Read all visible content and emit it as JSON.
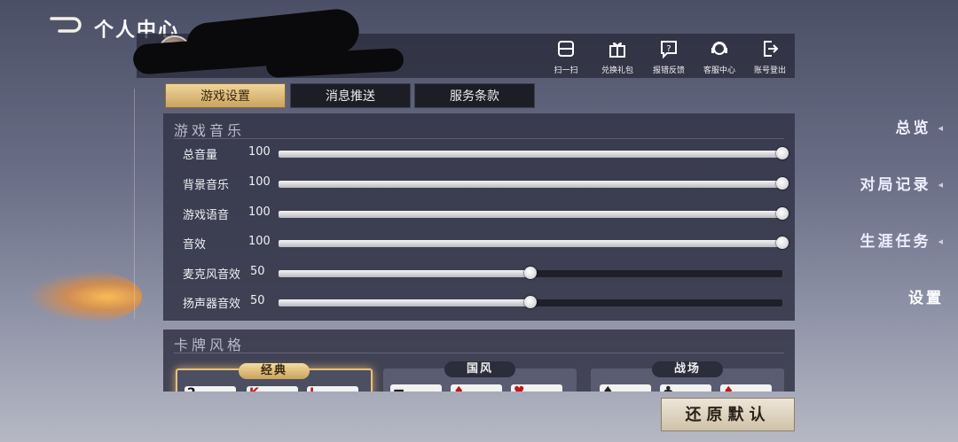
{
  "header": {
    "title": "个人中心"
  },
  "sidebar": {
    "items": [
      {
        "label": "总览"
      },
      {
        "label": "对局记录"
      },
      {
        "label": "生涯任务"
      },
      {
        "label": "设置"
      }
    ]
  },
  "top_actions": [
    {
      "label": "扫一扫",
      "icon": "scan-icon"
    },
    {
      "label": "兑换礼包",
      "icon": "gift-icon"
    },
    {
      "label": "报错反馈",
      "icon": "feedback-icon"
    },
    {
      "label": "客服中心",
      "icon": "support-icon"
    },
    {
      "label": "账号登出",
      "icon": "logout-icon"
    }
  ],
  "tabs": [
    {
      "label": "游戏设置",
      "active": true
    },
    {
      "label": "消息推送",
      "active": false
    },
    {
      "label": "服务条款",
      "active": false
    }
  ],
  "music": {
    "title": "游戏音乐",
    "rows": [
      {
        "label": "总音量",
        "value": 100
      },
      {
        "label": "背景音乐",
        "value": 100
      },
      {
        "label": "游戏语音",
        "value": 100
      },
      {
        "label": "音效",
        "value": 100
      },
      {
        "label": "麦克风音效",
        "value": 50
      },
      {
        "label": "扬声器音效",
        "value": 50
      }
    ]
  },
  "card_style": {
    "title": "卡牌风格",
    "options": [
      {
        "label": "经典",
        "selected": true
      },
      {
        "label": "国风",
        "selected": false
      },
      {
        "label": "战场",
        "selected": false
      }
    ]
  },
  "restore_button": {
    "label": "还原默认"
  },
  "colors": {
    "accent_gold": "#e8c27a",
    "panel": "#34364a"
  }
}
